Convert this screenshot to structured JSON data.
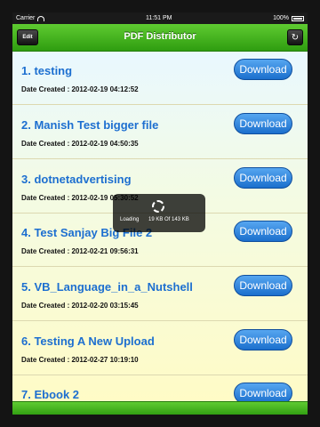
{
  "status_bar": {
    "carrier": "Carrier",
    "time": "11:51 PM",
    "battery": "100%"
  },
  "navbar": {
    "title": "PDF Distributor",
    "edit_label": "Edit"
  },
  "download_label": "Download",
  "files": [
    {
      "title": "1. testing",
      "date": "Date Created : 2012-02-19 04:12:52"
    },
    {
      "title": "2. Manish Test bigger file",
      "date": "Date Created : 2012-02-19 04:50:35"
    },
    {
      "title": "3. dotnetadvertising",
      "date": "Date Created : 2012-02-19 05:30:52"
    },
    {
      "title": "4. Test Sanjay Big File 2",
      "date": "Date Created : 2012-02-21 09:56:31"
    },
    {
      "title": "5. VB_Language_in_a_Nutshell",
      "date": "Date Created : 2012-02-20 03:15:45"
    },
    {
      "title": "6. Testing A New Upload",
      "date": "Date Created : 2012-02-27 10:19:10"
    },
    {
      "title": "7. Ebook 2",
      "date": ""
    }
  ],
  "loading": {
    "label": "Loading",
    "progress": "19 KB Of 143 KB"
  }
}
